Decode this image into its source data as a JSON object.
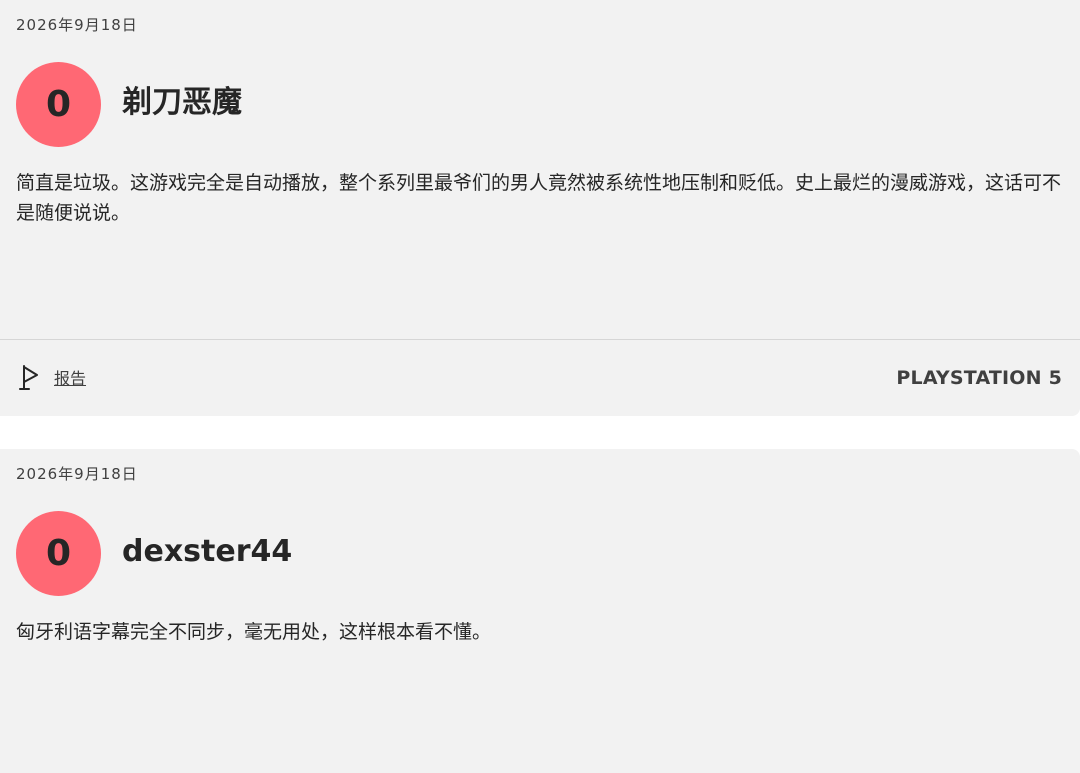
{
  "reviews": [
    {
      "date": "2026年9月18日",
      "score": "0",
      "author": "剃刀恶魔",
      "text": "简直是垃圾。这游戏完全是自动播放，整个系列里最爷们的男人竟然被系统性地压制和贬低。史上最烂的漫威游戏，这话可不是随便说说。",
      "report_label": "报告",
      "report_icon": "flag-icon",
      "platform": "PLAYSTATION 5"
    },
    {
      "date": "2026年9月18日",
      "score": "0",
      "author": "dexster44",
      "text": "匈牙利语字幕完全不同步，毫无用处，这样根本看不懂。"
    }
  ],
  "colors": {
    "score_negative": "#ff6874",
    "card_background": "#f2f2f2",
    "text_primary": "#262626"
  }
}
